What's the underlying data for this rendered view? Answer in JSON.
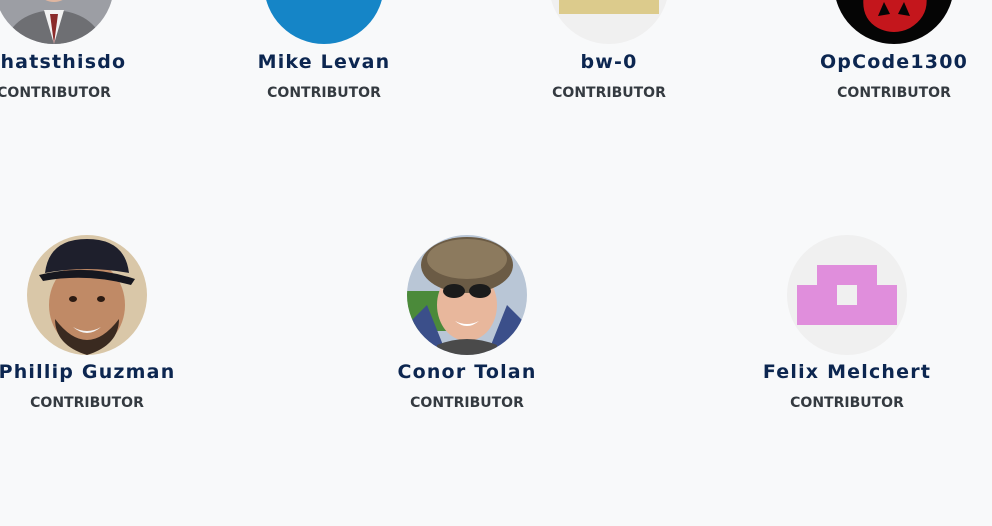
{
  "contributors_row_1": [
    {
      "name": "whatsthisdo",
      "role": "CONTRIBUTOR",
      "avatar": "photo-man-in-suit"
    },
    {
      "name": "Mike Levan",
      "role": "CONTRIBUTOR",
      "avatar": "blue-circle-avatar"
    },
    {
      "name": "bw-0",
      "role": "CONTRIBUTOR",
      "avatar": "tan-identicon"
    },
    {
      "name": "OpCode1300",
      "role": "CONTRIBUTOR",
      "avatar": "red-creature-on-black"
    }
  ],
  "contributors_row_2": [
    {
      "name": "Phillip Guzman",
      "role": "CONTRIBUTOR",
      "avatar": "photo-man-cap-beard"
    },
    {
      "name": "Conor Tolan",
      "role": "CONTRIBUTOR",
      "avatar": "photo-man-fur-hat-sunglasses"
    },
    {
      "name": "Felix Melchert",
      "role": "CONTRIBUTOR",
      "avatar": "pink-identicon"
    }
  ],
  "colors": {
    "background": "#f8f9fa",
    "name_text": "#0c2650",
    "role_text": "#343a40",
    "blue_avatar": "#1585c7",
    "identicon_pink": "#e08edc",
    "identicon_tan": "#dccb8c",
    "identicon_bg": "#f0f0f0"
  }
}
